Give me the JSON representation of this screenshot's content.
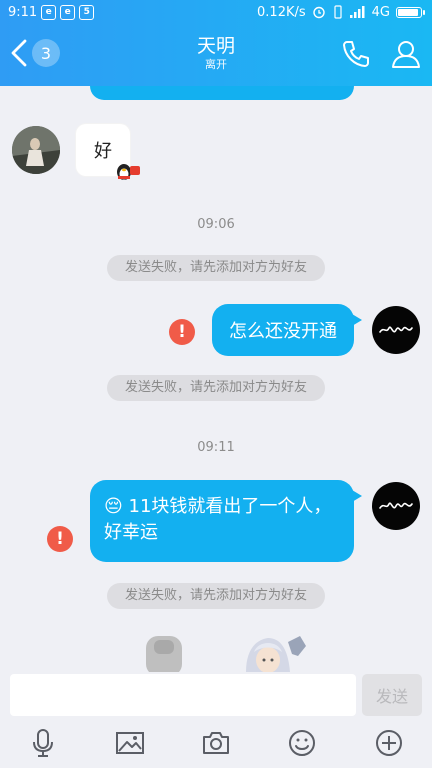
{
  "status_bar": {
    "time": "9:11",
    "speed": "0.12K/s",
    "network": "4G",
    "battery_level": 0.9,
    "notification_icons": [
      "browser-icon",
      "browser-icon",
      "5-app-icon"
    ]
  },
  "header": {
    "unread_count": "3",
    "title": "天明",
    "subtitle": "离开"
  },
  "messages": {
    "friend_text": "好",
    "time1": "09:06",
    "notice": "发送失败，请先添加对方为好友",
    "me_msg1": "怎么还没开通",
    "time2": "09:11",
    "me_msg2_line1": "11块钱就看出了一个人，",
    "me_msg2_line2": "好幸运",
    "emoji": "😔"
  },
  "input": {
    "send_label": "发送"
  },
  "colors": {
    "header_start": "#2f9cf4",
    "header_end": "#1ab8f3",
    "bubble_blue": "#13b0f0",
    "error_red": "#f05b48"
  }
}
